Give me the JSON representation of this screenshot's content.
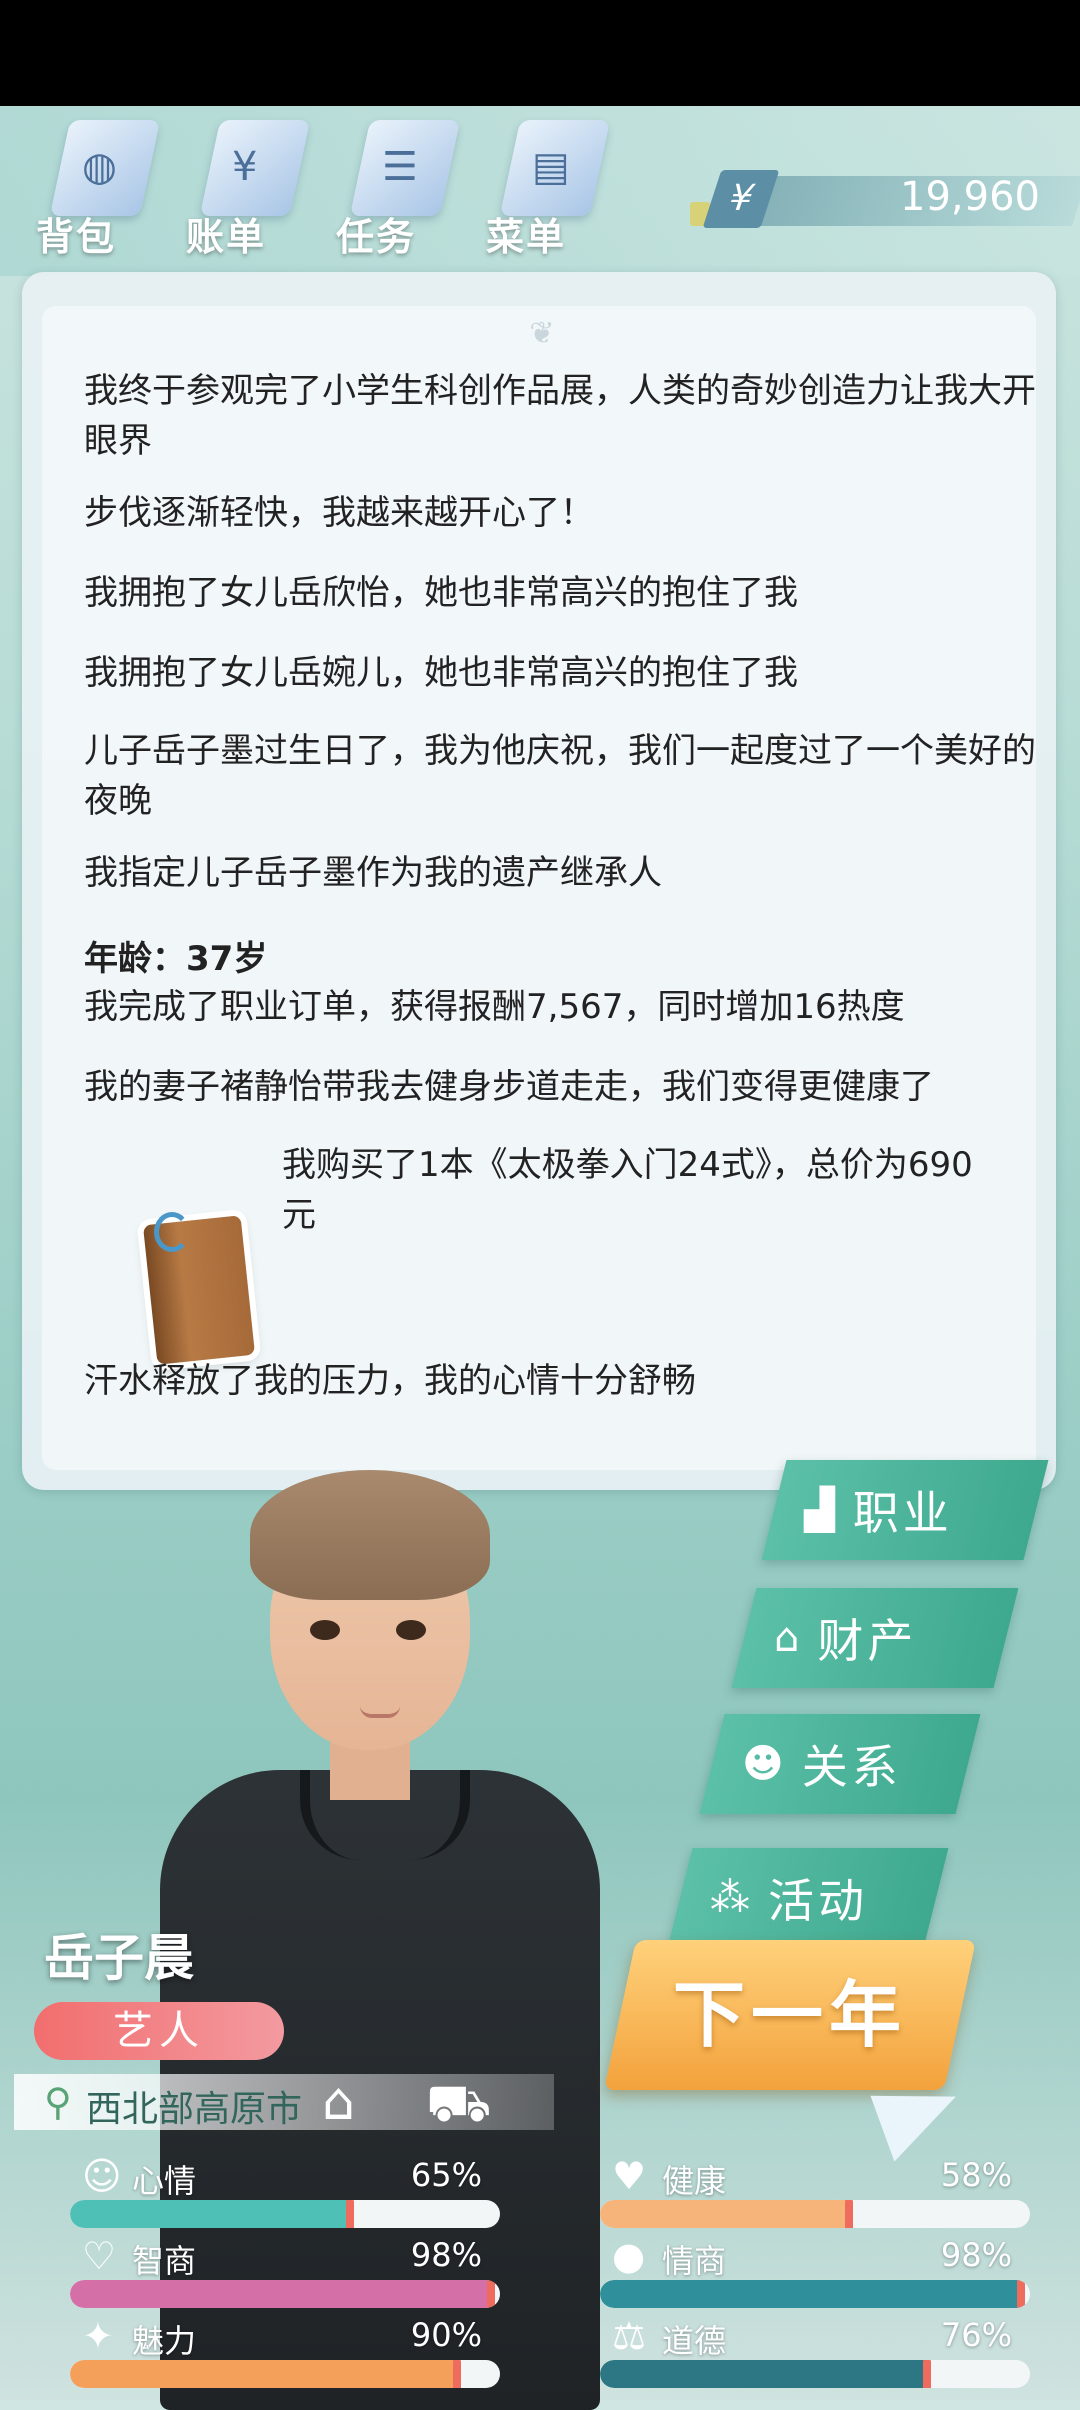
{
  "menu": [
    {
      "label": "背包",
      "glyph": "◍"
    },
    {
      "label": "账单",
      "glyph": "¥"
    },
    {
      "label": "任务",
      "glyph": "☰"
    },
    {
      "label": "菜单",
      "glyph": "▤"
    }
  ],
  "money": {
    "currency": "¥",
    "value": "19,960"
  },
  "log": {
    "entries": [
      {
        "text": "我终于参观完了小学生科创作品展，人类的奇妙创造力让我大开眼界"
      },
      {
        "text": "步伐逐渐轻快，我越来越开心了！"
      },
      {
        "text": "我拥抱了女儿岳欣怡，她也非常高兴的抱住了我"
      },
      {
        "text": "我拥抱了女儿岳婉儿，她也非常高兴的抱住了我"
      },
      {
        "text": "儿子岳子墨过生日了，我为他庆祝，我们一起度过了一个美好的夜晚"
      },
      {
        "text": "我指定儿子岳子墨作为我的遗产继承人"
      },
      {
        "text": "年龄：37岁"
      },
      {
        "text": "我完成了职业订单，获得报酬7,567，同时增加16热度"
      },
      {
        "text": "我的妻子褚静怡带我去健身步道走走，我们变得更健康了"
      },
      {
        "text": "我购买了1本《太极拳入门24式》，总价为690元"
      },
      {
        "text": "汗水释放了我的压力，我的心情十分舒畅"
      }
    ]
  },
  "side_menu": [
    {
      "label": "职业",
      "icon": "chart-icon"
    },
    {
      "label": "财产",
      "icon": "house-icon"
    },
    {
      "label": "关系",
      "icon": "people-icon"
    },
    {
      "label": "活动",
      "icon": "activity-icon"
    }
  ],
  "next_year_label": "下一年",
  "player": {
    "name": "岳子晨",
    "job": "艺人",
    "location": "西北部高原市"
  },
  "stats": [
    {
      "label": "心情",
      "pct": "65%",
      "value": 0.65,
      "color": "#4fc0b6",
      "icon": "smile-icon"
    },
    {
      "label": "健康",
      "pct": "58%",
      "value": 0.58,
      "color": "#f6b37a",
      "icon": "heart-icon"
    },
    {
      "label": "智商",
      "pct": "98%",
      "value": 0.98,
      "color": "#d46fa8",
      "icon": "brain-icon"
    },
    {
      "label": "情商",
      "pct": "98%",
      "value": 0.98,
      "color": "#2f8f9a",
      "icon": "apple-icon"
    },
    {
      "label": "魅力",
      "pct": "90%",
      "value": 0.9,
      "color": "#f4a05b",
      "icon": "star-icon"
    },
    {
      "label": "道德",
      "pct": "76%",
      "value": 0.76,
      "color": "#2d7785",
      "icon": "scale-icon"
    }
  ]
}
